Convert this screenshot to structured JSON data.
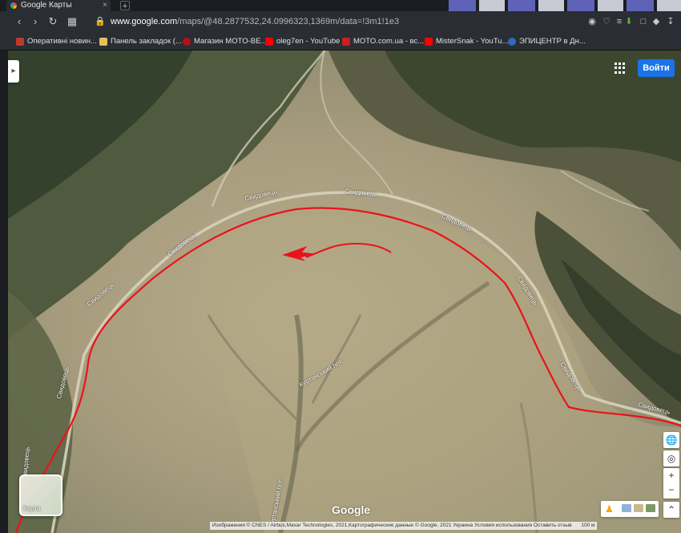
{
  "browser": {
    "tab_title": "Google Карты",
    "tab_close": "×",
    "new_tab": "+",
    "url_host": "www.google.com",
    "url_path": "/maps/@48.2877532,24.0996323,1369m/data=!3m1!1e3"
  },
  "bookmarks": [
    {
      "label": "Оперативні новин...",
      "color": "#c0392b"
    },
    {
      "label": "Панель закладок (...",
      "color": "#e2c15a"
    },
    {
      "label": "Магазин MOTO-BE...",
      "color": "#b31217"
    },
    {
      "label": "oleg7en - YouTube",
      "color": "#ff0000"
    },
    {
      "label": "MOTO.com.ua - вс...",
      "color": "#cc1f1f"
    },
    {
      "label": "MisterSnak - YouTu...",
      "color": "#ff0000"
    },
    {
      "label": "ЭПИЦЕНТР в Дн...",
      "color": "#2c6db5"
    }
  ],
  "map": {
    "signin_label": "Войти",
    "layer_label": "Карта",
    "google_logo": "Google",
    "attribution": "Изображения © CNES / Airbus,Maxar Technologies, 2021,Картографические данные © Google, 2021    Украина    Условия использования    Оставить отзыв",
    "scale": "100 м",
    "road_labels": [
      "Свидовець",
      "Свидовець",
      "Свидовець",
      "Свидовець",
      "Свидовець",
      "Свидовець",
      "Свидовець",
      "Свидовець"
    ],
    "creek_labels": [
      "Куртанський пот.",
      "Куртанський пот."
    ],
    "annotation_color": "#e8141b"
  }
}
